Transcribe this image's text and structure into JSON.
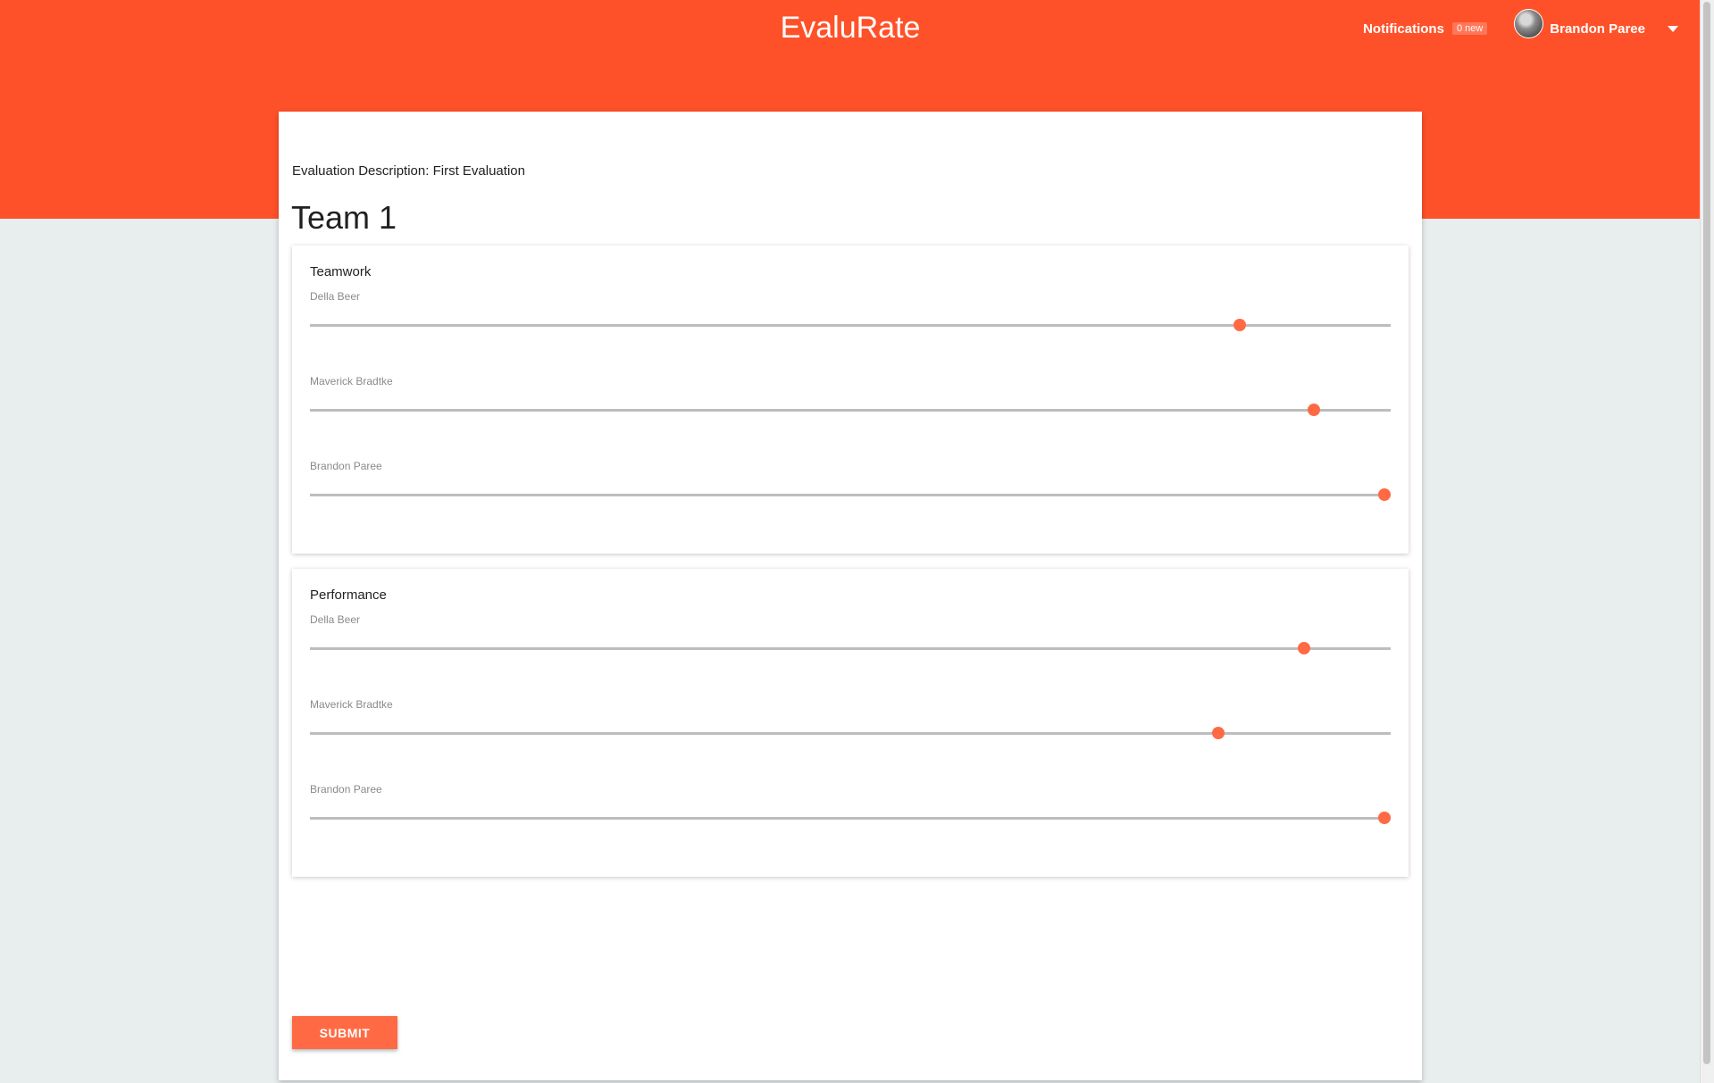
{
  "header": {
    "brand": "EvaluRate",
    "notifications_label": "Notifications",
    "notifications_badge": "0 new",
    "user_name": "Brandon Paree"
  },
  "evaluation": {
    "description": "Evaluation Description: First Evaluation",
    "team_name": "Team 1"
  },
  "criteria": [
    {
      "title": "Teamwork",
      "ratings": [
        {
          "member": "Della Beer",
          "value": 0.865
        },
        {
          "member": "Maverick Bradtke",
          "value": 0.934
        },
        {
          "member": "Brandon Paree",
          "value": 1.0
        }
      ]
    },
    {
      "title": "Performance",
      "ratings": [
        {
          "member": "Della Beer",
          "value": 0.925
        },
        {
          "member": "Maverick Bradtke",
          "value": 0.845
        },
        {
          "member": "Brandon Paree",
          "value": 1.0
        }
      ]
    }
  ],
  "actions": {
    "submit_label": "SUBMIT"
  },
  "colors": {
    "brand": "#ff5129",
    "accent": "#ff6a45",
    "background": "#e8eeee"
  }
}
